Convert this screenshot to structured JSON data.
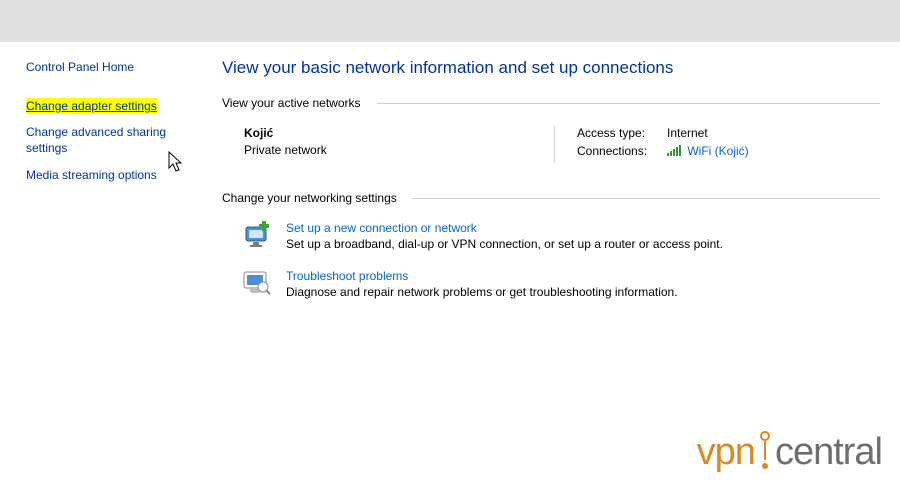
{
  "sidebar": {
    "home": "Control Panel Home",
    "items": [
      {
        "label": "Change adapter settings",
        "highlighted": true
      },
      {
        "label": "Change advanced sharing settings"
      },
      {
        "label": "Media streaming options"
      }
    ]
  },
  "main": {
    "title": "View your basic network information and set up connections",
    "active_header": "View your active networks",
    "network": {
      "name": "Kojić",
      "type": "Private network",
      "access_label": "Access type:",
      "access_value": "Internet",
      "conn_label": "Connections:",
      "conn_value": "WiFi (Kojić)"
    },
    "change_header": "Change your networking settings",
    "tasks": [
      {
        "title": "Set up a new connection or network",
        "desc": "Set up a broadband, dial-up or VPN connection, or set up a router or access point."
      },
      {
        "title": "Troubleshoot problems",
        "desc": "Diagnose and repair network problems or get troubleshooting information."
      }
    ]
  },
  "watermark": {
    "left": "vpn",
    "right": "central"
  }
}
